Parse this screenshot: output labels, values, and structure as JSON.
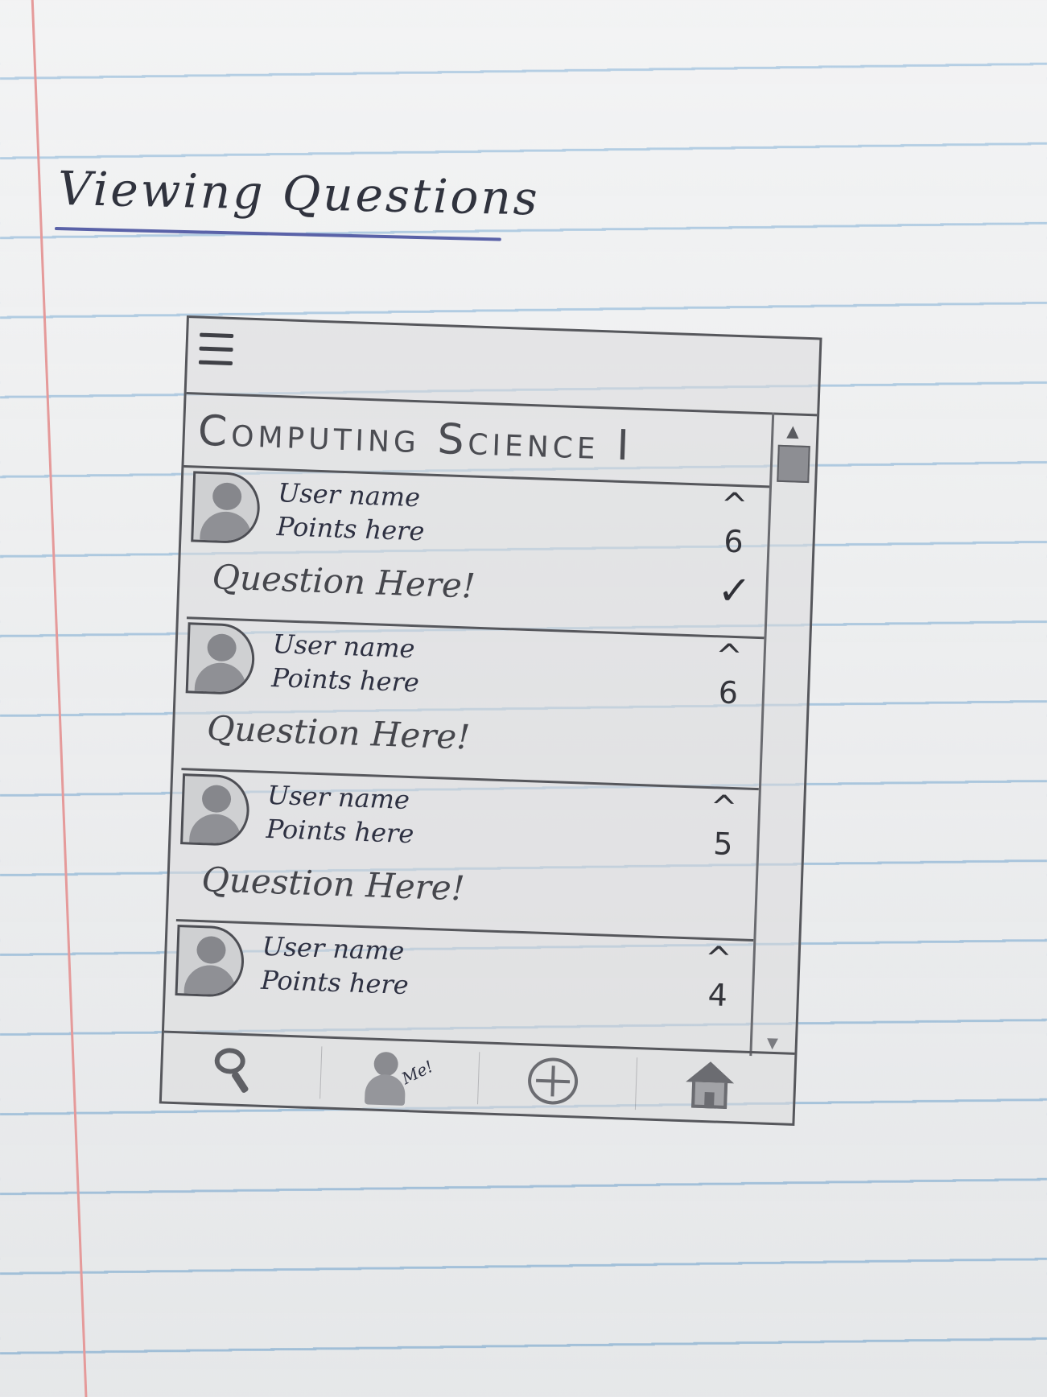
{
  "page": {
    "title": "Viewing Questions"
  },
  "app": {
    "course_title": "Computing Science I",
    "questions": [
      {
        "user_name": "User name",
        "points": "Points here",
        "question": "Question Here!",
        "votes": "6",
        "vote_icon": "^",
        "answered": true,
        "check_mark": "✓"
      },
      {
        "user_name": "User name",
        "points": "Points here",
        "question": "Question Here!",
        "votes": "6",
        "vote_icon": "^",
        "answered": false
      },
      {
        "user_name": "User name",
        "points": "Points here",
        "question": "Question Here!",
        "votes": "5",
        "vote_icon": "^",
        "answered": false
      },
      {
        "user_name": "User name",
        "points": "Points here",
        "question": "",
        "votes": "4",
        "vote_icon": "^",
        "answered": false
      }
    ],
    "scrollbar": {
      "up_glyph": "▲",
      "down_glyph": "▼"
    },
    "bottom_nav": {
      "items": [
        {
          "icon": "search-icon"
        },
        {
          "icon": "profile-icon",
          "label": "Me!"
        },
        {
          "icon": "add-icon"
        },
        {
          "icon": "home-icon"
        }
      ]
    }
  }
}
